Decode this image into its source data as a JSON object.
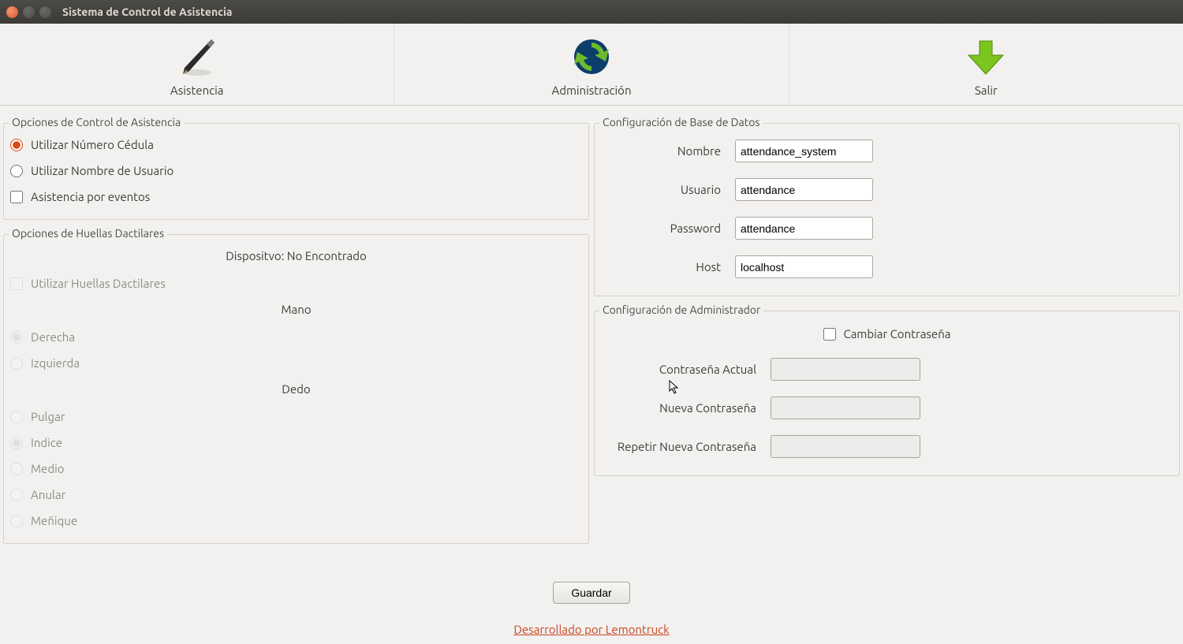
{
  "window": {
    "title": "Sistema de Control de Asistencia"
  },
  "toolbar": {
    "asistencia": "Asistencia",
    "administracion": "Administración",
    "salir": "Salir"
  },
  "left": {
    "control_title": "Opciones de Control de Asistencia",
    "radio_cedula": "Utilizar Número Cédula",
    "radio_usuario": "Utilizar Nombre de Usuario",
    "check_eventos": "Asistencia por eventos",
    "finger_title": "Opciones de Huellas Dactilares",
    "device_status": "Dispositvo: No Encontrado",
    "use_fingerprint": "Utilizar Huellas Dactilares",
    "hand_label": "Mano",
    "hand_right": "Derecha",
    "hand_left": "Izquierda",
    "finger_label": "Dedo",
    "fingers": {
      "pulgar": "Pulgar",
      "indice": "Indice",
      "medio": "Medio",
      "anular": "Anular",
      "menique": "Meñique"
    }
  },
  "right": {
    "db_title": "Configuración de Base de Datos",
    "db_name_label": "Nombre",
    "db_user_label": "Usuario",
    "db_pass_label": "Password",
    "db_host_label": "Host",
    "db_name_value": "attendance_system",
    "db_user_value": "attendance",
    "db_pass_value": "attendance",
    "db_host_value": "localhost",
    "admin_title": "Configuración de Administrador",
    "change_pw_label": "Cambiar Contraseña",
    "current_pw_label": "Contraseña Actual",
    "new_pw_label": "Nueva Contraseña",
    "repeat_pw_label": "Repetir Nueva Contraseña"
  },
  "actions": {
    "save": "Guardar"
  },
  "footer": {
    "credit": "Desarrollado por Lemontruck"
  }
}
